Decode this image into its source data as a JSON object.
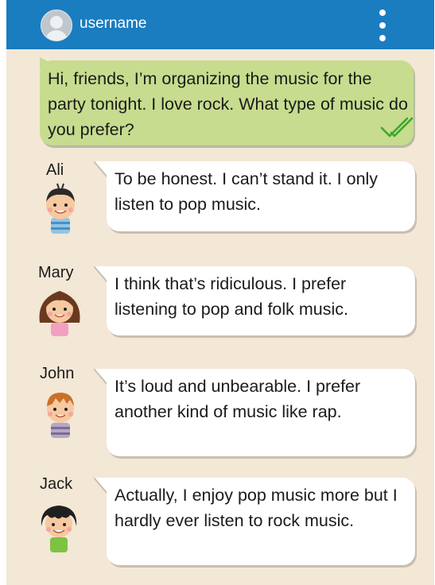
{
  "header": {
    "username": "username"
  },
  "sent": {
    "text": "Hi, friends, I’m organizing the music for the party tonight. I love rock. What type of music do you prefer?",
    "status_icon": "double-check-icon"
  },
  "messages": [
    {
      "name": "Ali",
      "text": "To be honest. I can’t stand it. I only listen to pop music."
    },
    {
      "name": "Mary",
      "text": "I think that’s ridiculous.  I prefer listening to pop and folk music."
    },
    {
      "name": "John",
      "text": "It’s loud and unbearable. I prefer another kind of music like rap."
    },
    {
      "name": "Jack",
      "text": "Actually, I enjoy pop music more but I hardly ever listen to rock music."
    }
  ],
  "colors": {
    "header": "#1a7dbf",
    "background": "#f3e7d6",
    "sent_bubble": "#c7dc8e",
    "received_bubble": "#ffffff",
    "check": "#3aa62a"
  }
}
